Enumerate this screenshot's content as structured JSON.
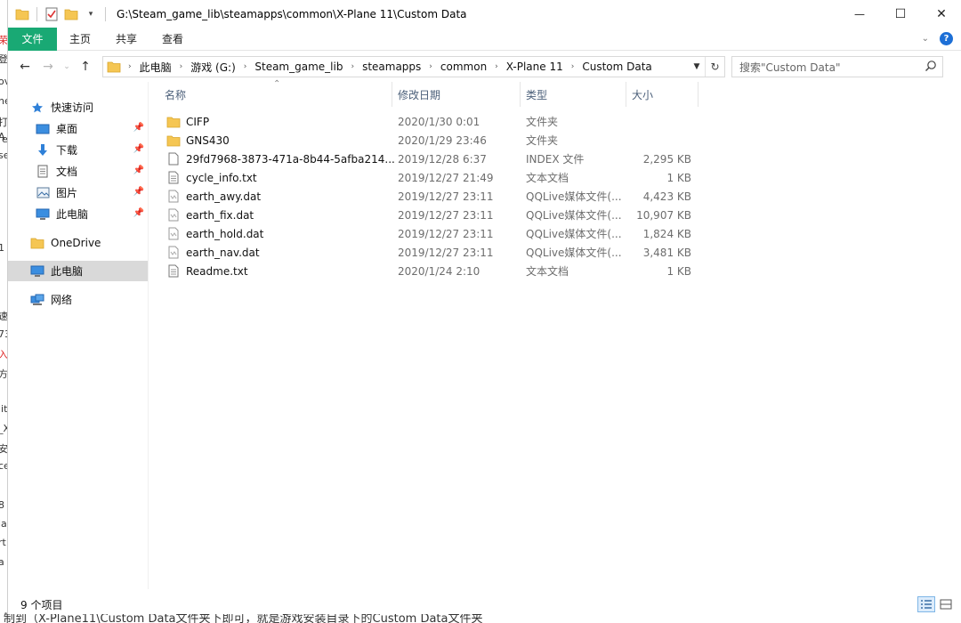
{
  "background": {
    "edge_fragments": [
      "荣",
      "登",
      "ov",
      "ne",
      "打",
      "A",
      "e",
      "se",
      "1",
      "速",
      "73",
      "入",
      "方",
      "lit",
      "_X",
      "安",
      "ce",
      "8",
      "la",
      "rt",
      "a"
    ],
    "bottom_text": "制到（X-Plane11\\Custom Data文件夹下即可，就是游戏安装目录下的Custom Data文件夹"
  },
  "window": {
    "title": "G:\\Steam_game_lib\\steamapps\\common\\X-Plane 11\\Custom Data",
    "controls": {
      "minimize": "—",
      "maximize": "☐",
      "close": "✕"
    }
  },
  "ribbon": {
    "tabs": [
      {
        "label": "文件"
      },
      {
        "label": "主页"
      },
      {
        "label": "共享"
      },
      {
        "label": "查看"
      }
    ]
  },
  "address": {
    "crumbs": [
      "此电脑",
      "游戏 (G:)",
      "Steam_game_lib",
      "steamapps",
      "common",
      "X-Plane 11",
      "Custom Data"
    ],
    "search_placeholder": "搜索\"Custom Data\""
  },
  "nav_pane": {
    "items": [
      {
        "label": "快速访问",
        "icon": "star-icon"
      },
      {
        "label": "桌面",
        "icon": "desktop-icon",
        "pinned": true
      },
      {
        "label": "下载",
        "icon": "download-icon",
        "pinned": true
      },
      {
        "label": "文档",
        "icon": "document-icon",
        "pinned": true
      },
      {
        "label": "图片",
        "icon": "picture-icon",
        "pinned": true
      },
      {
        "label": "此电脑",
        "icon": "pc-icon",
        "pinned": true
      },
      {
        "label": "OneDrive",
        "icon": "folder-icon"
      },
      {
        "label": "此电脑",
        "icon": "pc-icon",
        "selected": true
      },
      {
        "label": "网络",
        "icon": "network-icon"
      }
    ]
  },
  "columns": {
    "name": "名称",
    "date": "修改日期",
    "type": "类型",
    "size": "大小"
  },
  "files": [
    {
      "name": "CIFP",
      "date": "2020/1/30 0:01",
      "type": "文件夹",
      "size": "",
      "icon": "folder-icon"
    },
    {
      "name": "GNS430",
      "date": "2020/1/29 23:46",
      "type": "文件夹",
      "size": "",
      "icon": "folder-icon"
    },
    {
      "name": "29fd7968-3873-471a-8b44-5afba214...",
      "date": "2019/12/28 6:37",
      "type": "INDEX 文件",
      "size": "2,295 KB",
      "icon": "file-icon"
    },
    {
      "name": "cycle_info.txt",
      "date": "2019/12/27 21:49",
      "type": "文本文档",
      "size": "1 KB",
      "icon": "text-file-icon"
    },
    {
      "name": "earth_awy.dat",
      "date": "2019/12/27 23:11",
      "type": "QQLive媒体文件(...",
      "size": "4,423 KB",
      "icon": "media-file-icon"
    },
    {
      "name": "earth_fix.dat",
      "date": "2019/12/27 23:11",
      "type": "QQLive媒体文件(...",
      "size": "10,907 KB",
      "icon": "media-file-icon"
    },
    {
      "name": "earth_hold.dat",
      "date": "2019/12/27 23:11",
      "type": "QQLive媒体文件(...",
      "size": "1,824 KB",
      "icon": "media-file-icon"
    },
    {
      "name": "earth_nav.dat",
      "date": "2019/12/27 23:11",
      "type": "QQLive媒体文件(...",
      "size": "3,481 KB",
      "icon": "media-file-icon"
    },
    {
      "name": "Readme.txt",
      "date": "2020/1/24 2:10",
      "type": "文本文档",
      "size": "1 KB",
      "icon": "text-file-icon"
    }
  ],
  "status": {
    "count": "9 个项目"
  }
}
